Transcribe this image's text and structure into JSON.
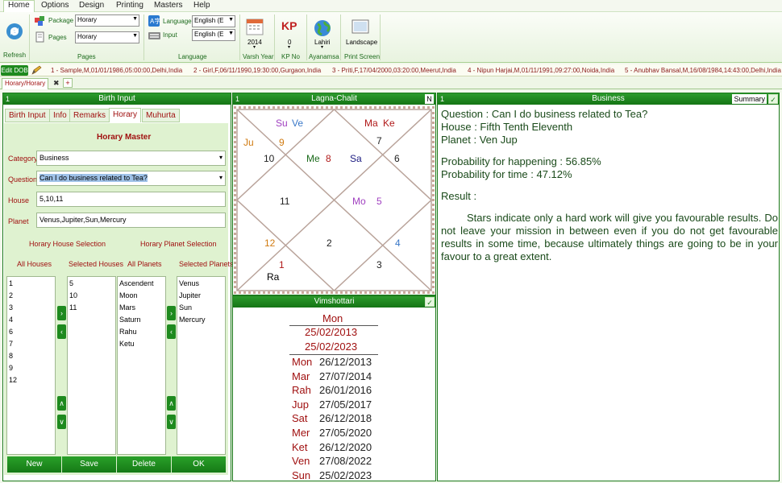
{
  "menu": [
    "Home",
    "Options",
    "Design",
    "Printing",
    "Masters",
    "Help"
  ],
  "ribbon": {
    "refresh": "Refresh",
    "package_label": "Package",
    "package_value": "Horary",
    "pages_label": "Pages",
    "pages_value": "Horary",
    "pages_group": "Pages",
    "language_label": "Language",
    "language_value": "English (E",
    "input_label": "Input",
    "input_value": "English (E",
    "language_group": "Language",
    "varsh_value": "2014",
    "varsh_group": "Varsh Year",
    "kp_icon_text": "KP",
    "kp_value": "0",
    "kp_group": "KP No",
    "ayanamsa_value": "Lahiri",
    "ayanamsa_group": "Ayanamsa",
    "print_value": "Landscape",
    "print_group": "Print Screen"
  },
  "recent": {
    "edit_dob": "Edit DOB",
    "items": [
      "1 - Sample,M,01/01/1986,05:00:00,Delhi,India",
      "2 - Girl,F,06/11/1990,19:30:00,Gurgaon,India",
      "3 - Priti,F,17/04/2000,03:20:00,Meerut,India",
      "4 - Nipun Harjai,M,01/11/1991,09:27:00,Noida,India",
      "5 - Anubhav Bansal,M,16/08/1984,14:43:00,Delhi,India"
    ]
  },
  "doc_tab": "Horary/Horary",
  "birth": {
    "num": "1",
    "title": "Birth Input",
    "tabs": [
      "Birth Input",
      "Info",
      "Remarks",
      "Horary",
      "Muhurta"
    ],
    "master_title": "Horary Master",
    "category_label": "Category",
    "category_value": "Business",
    "question_label": "Question",
    "question_value": "Can I do business related to Tea?",
    "house_label": "House",
    "house_value": "5,10,11",
    "planet_label": "Planet",
    "planet_value": "Venus,Jupiter,Sun,Mercury",
    "house_sel_title": "Horary House Selection",
    "planet_sel_title": "Horary Planet Selection",
    "all_houses": "All Houses",
    "selected_houses": "Selected Houses",
    "all_planets": "All Planets",
    "selected_planets": "Selected Planets",
    "all_houses_list": [
      "1",
      "2",
      "3",
      "4",
      "6",
      "7",
      "8",
      "9",
      "12"
    ],
    "selected_houses_list": [
      "5",
      "10",
      "11"
    ],
    "all_planets_list": [
      "Ascendent",
      "Moon",
      "Mars",
      "Saturn",
      "Rahu",
      "Ketu"
    ],
    "selected_planets_list": [
      "Venus",
      "Jupiter",
      "Sun",
      "Mercury"
    ],
    "arrows": {
      "right": "›",
      "left": "‹",
      "up": "∧",
      "down": "∨"
    },
    "buttons": [
      "New",
      "Save",
      "Delete",
      "OK"
    ]
  },
  "chart": {
    "num": "1",
    "title": "Lagna-Chalit",
    "flag": "N",
    "labels": [
      {
        "t": "Su",
        "c": "#a040c0"
      },
      {
        "t": "Ve",
        "c": "#3a78c8"
      },
      {
        "t": "Ma",
        "c": "#b01818"
      },
      {
        "t": "Ke",
        "c": "#b01818"
      },
      {
        "t": "Ju",
        "c": "#d07a10"
      },
      {
        "t": "9",
        "c": "#d07a10"
      },
      {
        "t": "7",
        "c": "#222"
      },
      {
        "t": "10",
        "c": "#222"
      },
      {
        "t": "Me",
        "c": "#1a6a1a"
      },
      {
        "t": "8",
        "c": "#b01818"
      },
      {
        "t": "Sa",
        "c": "#1a1a80"
      },
      {
        "t": "6",
        "c": "#222"
      },
      {
        "t": "11",
        "c": "#222"
      },
      {
        "t": "Mo",
        "c": "#a040c0"
      },
      {
        "t": "5",
        "c": "#a040c0"
      },
      {
        "t": "12",
        "c": "#d07a10"
      },
      {
        "t": "2",
        "c": "#222"
      },
      {
        "t": "4",
        "c": "#3a78c8"
      },
      {
        "t": "1",
        "c": "#b01818"
      },
      {
        "t": "3",
        "c": "#222"
      },
      {
        "t": "Ra",
        "c": "#000"
      }
    ]
  },
  "vims": {
    "title": "Vimshottari",
    "head": "Mon",
    "from": "25/02/2013",
    "to": "25/02/2023",
    "rows": [
      {
        "p": "Mon",
        "d": "26/12/2013"
      },
      {
        "p": "Mar",
        "d": "27/07/2014"
      },
      {
        "p": "Rah",
        "d": "26/01/2016"
      },
      {
        "p": "Jup",
        "d": "27/05/2017"
      },
      {
        "p": "Sat",
        "d": "26/12/2018"
      },
      {
        "p": "Mer",
        "d": "27/05/2020"
      },
      {
        "p": "Ket",
        "d": "26/12/2020"
      },
      {
        "p": "Ven",
        "d": "27/08/2022"
      },
      {
        "p": "Sun",
        "d": "25/02/2023"
      }
    ]
  },
  "business": {
    "num": "1",
    "title": "Business",
    "summary": "Summary",
    "question": "Question : Can I do business related to Tea?",
    "house": "House : Fifth Tenth Eleventh",
    "planet": "Planet : Ven Jup",
    "prob_happen": "Probability for happening : 56.85%",
    "prob_time": "Probability for time : 47.12%",
    "result_label": "Result :",
    "result_text": "Stars indicate only a hard work will give you favourable results. Do not leave your mission in between even if you do not get favourable results in some time, because ultimately things are going to be in your favour to a great extent."
  },
  "icons": [
    "refresh-icon",
    "package-icon",
    "pages-icon",
    "language-icon",
    "input-icon",
    "calendar-icon",
    "kp-icon",
    "globe-icon",
    "print-icon",
    "pencil-icon",
    "close-icon",
    "plus-icon",
    "check-icon"
  ]
}
